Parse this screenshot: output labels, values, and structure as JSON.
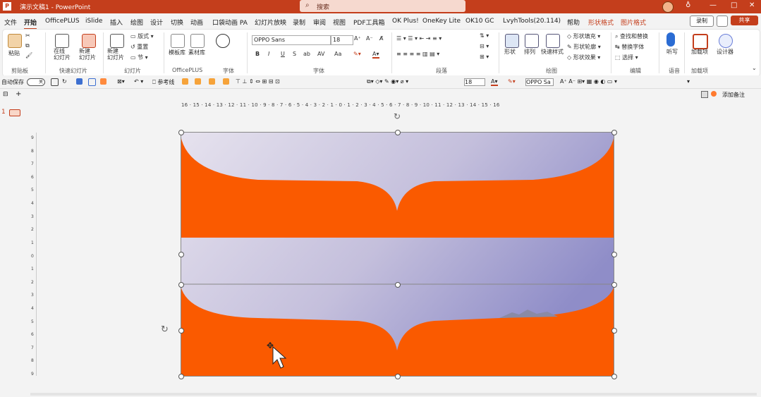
{
  "titlebar": {
    "app_icon": "P",
    "title": "演示文稿1  -  PowerPoint",
    "search_placeholder": "搜索",
    "search_icon": "search-icon",
    "bell_icon": "lightbulb-icon",
    "window_controls": [
      "—",
      "□",
      "✕"
    ]
  },
  "tabs": [
    {
      "label": "文件"
    },
    {
      "label": "开始"
    },
    {
      "label": "OfficePLUS"
    },
    {
      "label": "iSlide"
    },
    {
      "label": "插入"
    },
    {
      "label": "绘图"
    },
    {
      "label": "设计"
    },
    {
      "label": "切换"
    },
    {
      "label": "动画"
    },
    {
      "label": "口袋动画 PA"
    },
    {
      "label": "幻灯片放映"
    },
    {
      "label": "录制"
    },
    {
      "label": "审阅"
    },
    {
      "label": "视图"
    },
    {
      "label": "PDF工具箱"
    },
    {
      "label": "OK Plus!"
    },
    {
      "label": "OneKey Lite"
    },
    {
      "label": "OK10 GC"
    },
    {
      "label": "LvyhTools(20.114)"
    },
    {
      "label": "帮助"
    },
    {
      "label": "形状格式"
    },
    {
      "label": "图片格式"
    }
  ],
  "header_buttons": {
    "record": "录制",
    "share": "共享"
  },
  "ribbon": {
    "groups": [
      {
        "label": "剪贴板"
      },
      {
        "label": "快速幻灯片"
      },
      {
        "label": "幻灯片"
      },
      {
        "label": "OfficePLUS"
      },
      {
        "label": "字体"
      },
      {
        "label": "字体"
      },
      {
        "label": "段落"
      },
      {
        "label": "绘图"
      },
      {
        "label": "编辑"
      },
      {
        "label": "语音"
      },
      {
        "label": "加载项"
      }
    ],
    "paste": "粘贴",
    "new_slide_one": "在线\n幻灯片",
    "new_slide_two": "新建\n幻灯片",
    "add_slide": "新建\n幻灯片",
    "layout": "版式",
    "reset": "重置",
    "section": "节",
    "template": "模板库",
    "material": "素材库",
    "font_name": "OPPO Sans",
    "font_size": "18",
    "shape_fill": "形状填充",
    "shape_outline": "形状轮廓",
    "shape_effect": "形状效果",
    "find_replace": "查找和替换",
    "replace_font": "替换字体",
    "select": "选择",
    "arrange": "排列",
    "quick_styles": "快速样式",
    "shapes": "形状",
    "dictate": "听写",
    "addins": "加载项",
    "designer": "设计器"
  },
  "qat": {
    "autosave": "自动保存",
    "toggle_state": "关",
    "font_name": "OPPO Sa",
    "font_size": "18",
    "ref_lines": "参考线",
    "extra": "添加备注"
  },
  "ruler_h": "16 · 15 · 14 · 13 · 12 · 11 · 10 · 9 · 8 · 7 · 6 · 5 · 4 · 3 · 2 · 1 · 0 · 1 · 2 · 3 · 4 · 5 · 6 · 7 · 8 · 9 · 10 · 11 · 12 · 13 · 14 · 15 · 16",
  "ruler_v": [
    "9",
    "8",
    "7",
    "6",
    "5",
    "4",
    "3",
    "2",
    "1",
    "0",
    "1",
    "2",
    "3",
    "4",
    "5",
    "6",
    "7",
    "8",
    "9"
  ],
  "slide_panel": {
    "number": "1"
  },
  "colors": {
    "accent": "#c43e1c",
    "shape_orange": "#fa5a00",
    "sky_top": "#d7d2e3",
    "sky_bottom": "#8e8cc7"
  }
}
